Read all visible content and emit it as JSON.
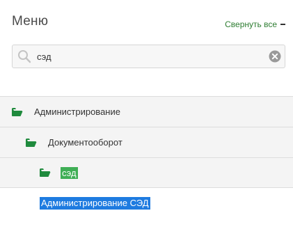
{
  "header": {
    "title": "Меню",
    "collapse_all_label": "Свернуть все"
  },
  "search": {
    "value": "сэд",
    "placeholder": ""
  },
  "tree": {
    "items": [
      {
        "label": "Администрирование",
        "level": 1
      },
      {
        "label": "Документооборот",
        "level": 2
      },
      {
        "label": "сэд",
        "level": 3
      }
    ],
    "leaf": {
      "label": "Администрирование СЭД"
    }
  },
  "colors": {
    "accent_green": "#2e7d32",
    "folder_green": "#1f8a3d",
    "match_highlight": "#3fae55",
    "selected_link": "#1e7be0"
  },
  "icons": [
    "search-icon",
    "clear-icon",
    "folder-open-icon",
    "minus-icon"
  ]
}
